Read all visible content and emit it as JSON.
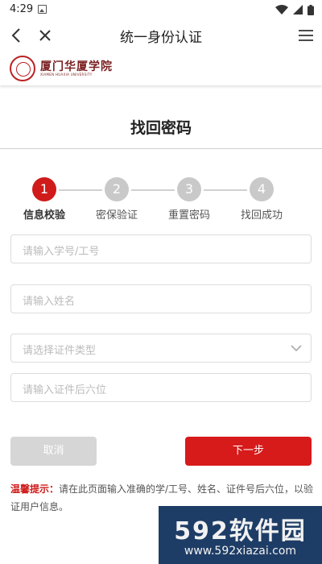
{
  "status_bar": {
    "time": "4:29"
  },
  "titlebar": {
    "title": "统一身份认证"
  },
  "logo": {
    "name": "厦门华厦学院",
    "subtitle": "XIAMEN HUAXIA UNIVERSITY"
  },
  "page": {
    "title": "找回密码"
  },
  "steps": [
    {
      "number": "1",
      "label": "信息校验",
      "active": true
    },
    {
      "number": "2",
      "label": "密保验证",
      "active": false
    },
    {
      "number": "3",
      "label": "重置密码",
      "active": false
    },
    {
      "number": "4",
      "label": "找回成功",
      "active": false
    }
  ],
  "form": {
    "id_placeholder": "请输入学号/工号",
    "name_placeholder": "请输入姓名",
    "cert_type_placeholder": "请选择证件类型",
    "cert_last6_placeholder": "请输入证件后六位"
  },
  "buttons": {
    "cancel": "取消",
    "next": "下一步"
  },
  "tip": {
    "label": "温馨提示：",
    "text": "请在此页面输入准确的学/工号、姓名、证件号后六位，以验证用户信息。"
  },
  "watermark": {
    "brand": "592软件园",
    "url": "www.592xiazai.com"
  },
  "colors": {
    "accent": "#d01b1b",
    "inactive_step": "#c9c9c9",
    "watermark_bg": "#1e3d66"
  }
}
